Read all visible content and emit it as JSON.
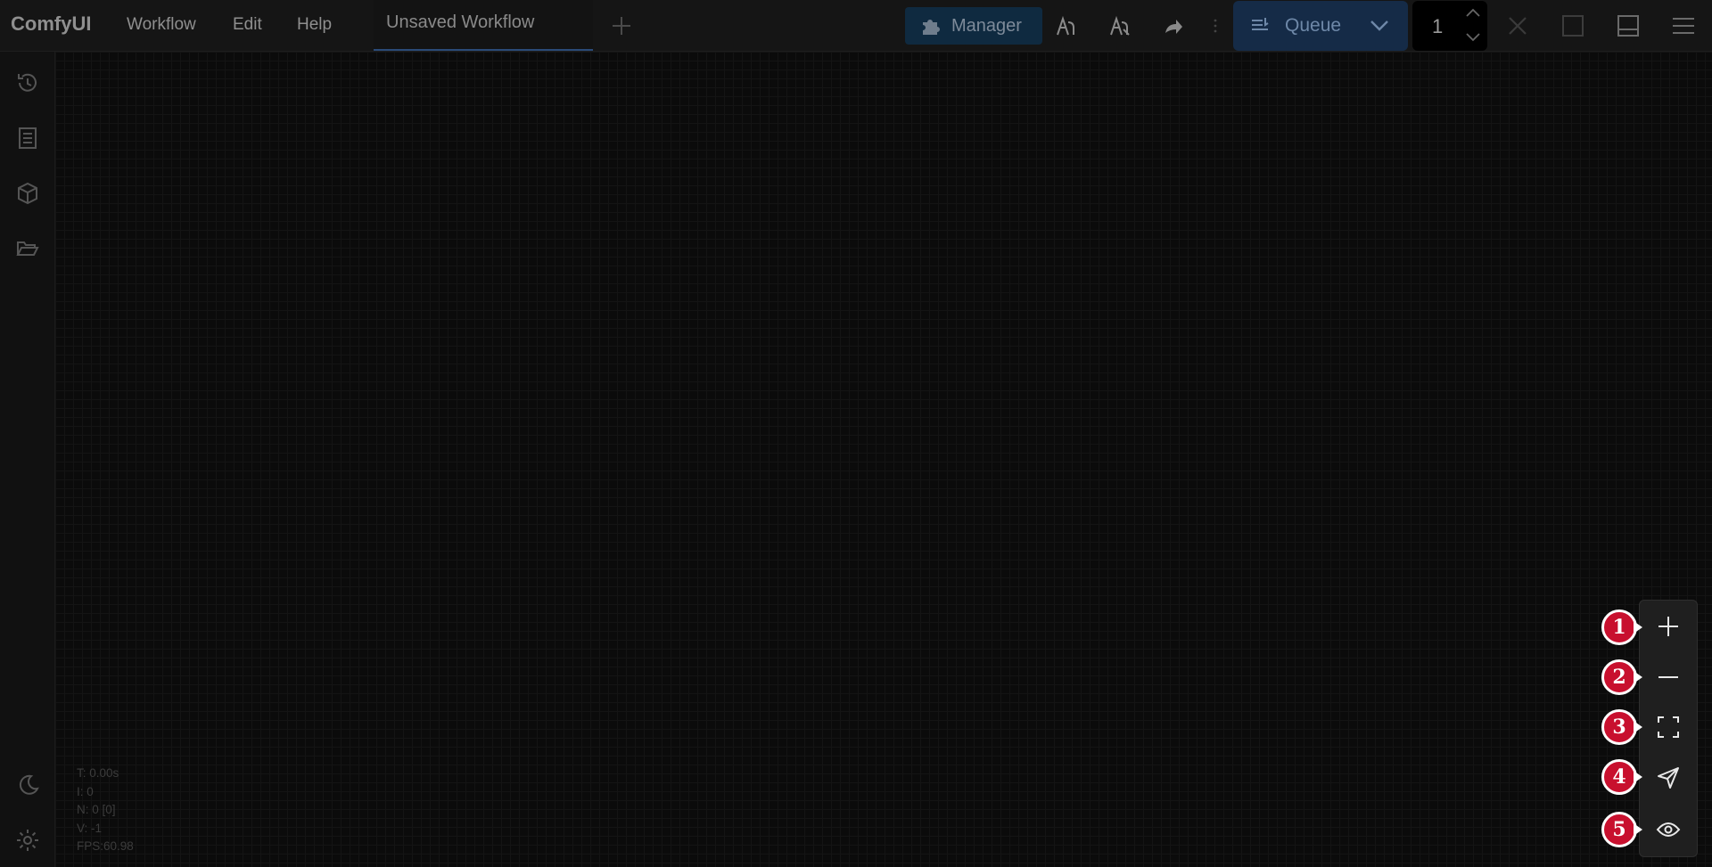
{
  "app": {
    "title": "ComfyUI"
  },
  "menu": {
    "workflow": "Workflow",
    "edit": "Edit",
    "help": "Help"
  },
  "tab": {
    "label": "Unsaved Workflow"
  },
  "toolbar": {
    "manager_label": "Manager",
    "queue_label": "Queue",
    "batch_count": "1"
  },
  "stats": {
    "t": "T: 0.00s",
    "i": "I: 0",
    "n": "N: 0 [0]",
    "v": "V: -1",
    "fps": "FPS:60.98"
  },
  "zoom_markers": [
    "1",
    "2",
    "3",
    "4",
    "5"
  ],
  "colors": {
    "marker": "#c8102e",
    "queue_bg": "#152b47",
    "manager_bg": "#0f2a40",
    "tab_underline": "#2a4a78"
  }
}
